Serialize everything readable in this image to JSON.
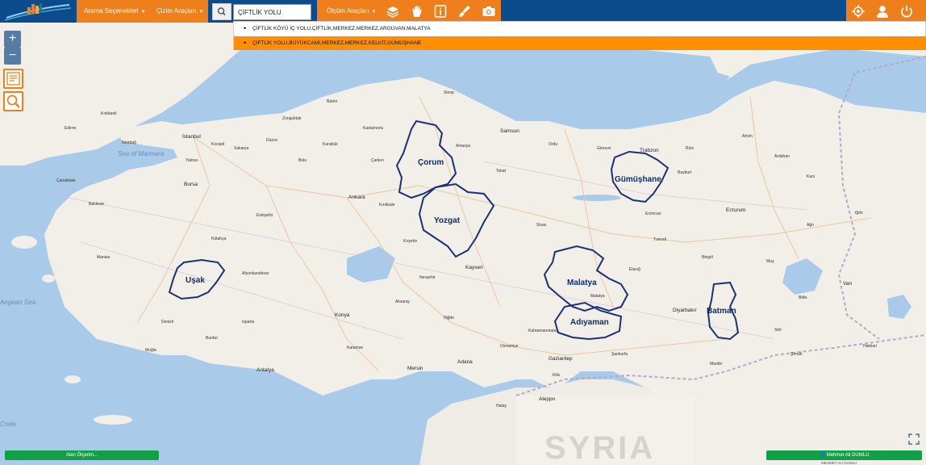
{
  "toolbar": {
    "search_options_label": "Arama Seçenekleri",
    "drawing_tools_label": "Çizim Araçları",
    "measure_tools_label": "Ölçüm Araçları",
    "search_value": "ÇİFTLİK YOLU",
    "icons": [
      "search-icon",
      "layers-icon",
      "hand-pan-icon",
      "info-icon",
      "brush-icon",
      "camera-icon",
      "locate-icon",
      "user-icon",
      "power-icon"
    ]
  },
  "search_results": [
    "ÇİFTLİK KÖYÜ İÇ YOLU,ÇİFTLİK,MERKEZ,MERKEZ,ARGUVAN,MALATYA",
    "ÇİFTLİK YOLU,BÜYÜKCAMİ,MERKEZ,MERKEZ,KELKİT,GÜMÜŞHANE"
  ],
  "map": {
    "zoom_in": "+",
    "zoom_out": "−",
    "highlighted_provinces": [
      "Çorum",
      "Yozgat",
      "Uşak",
      "Malatya",
      "Adıyaman",
      "Gümüşhane",
      "Batman"
    ],
    "colors": {
      "land": "#f1efe8",
      "sea": "#a9cbe9",
      "boundary": "#1c2f78",
      "toolbar": "#0d4c8c",
      "accent": "#ef7f1a"
    },
    "water_labels": [
      "Sea of Marmara",
      "Aegean Sea",
      "Crete"
    ],
    "country_label": "SYRIA",
    "cities": [
      "Ankara",
      "İstanbul",
      "Bursa",
      "Kayseri",
      "Konya",
      "Adana",
      "Mersin",
      "Antalya",
      "Samsun",
      "Trabzon",
      "Erzurum",
      "Van",
      "Diyarbakır",
      "Gaziantep",
      "Sivas",
      "Eskişehir",
      "Kütahya",
      "Isparta",
      "Muğla",
      "Elazığ",
      "Şanlıurfa",
      "Kırşehir",
      "Aksaray",
      "Niğde",
      "Kahramanmaraş",
      "Aleppo",
      "Hatay",
      "Tokat",
      "Amasya",
      "Sinop",
      "Kastamonu",
      "Zonguldak",
      "Bolu",
      "Balıkesir",
      "Manisa",
      "Denizli",
      "Nevşehir",
      "Karaman",
      "Malatya",
      "Mardin",
      "Bingöl",
      "Muş",
      "Erzincan",
      "Bitlis",
      "Siirt",
      "Kırıkkale",
      "Çankırı",
      "Karabük",
      "Bartın",
      "Düzce",
      "Sakarya",
      "Kocaeli",
      "Yalova",
      "Çanakkale",
      "Edirne",
      "Tekirdağ",
      "Kırklareli",
      "Burdur",
      "Afyonkarahisar",
      "Ordu",
      "Giresun",
      "Rize",
      "Artvin",
      "Bayburt",
      "Kars",
      "Ağrı",
      "Iğdır",
      "Ardahan",
      "Tunceli",
      "Hakkari",
      "Şırnak",
      "Kilis",
      "Osmaniye"
    ]
  },
  "bottom": {
    "left_button": "Alan Ölçerim...",
    "user_name": "Mehmet Ali DUMLU",
    "footer_text": "MEHMET ALİ DUMLU"
  }
}
